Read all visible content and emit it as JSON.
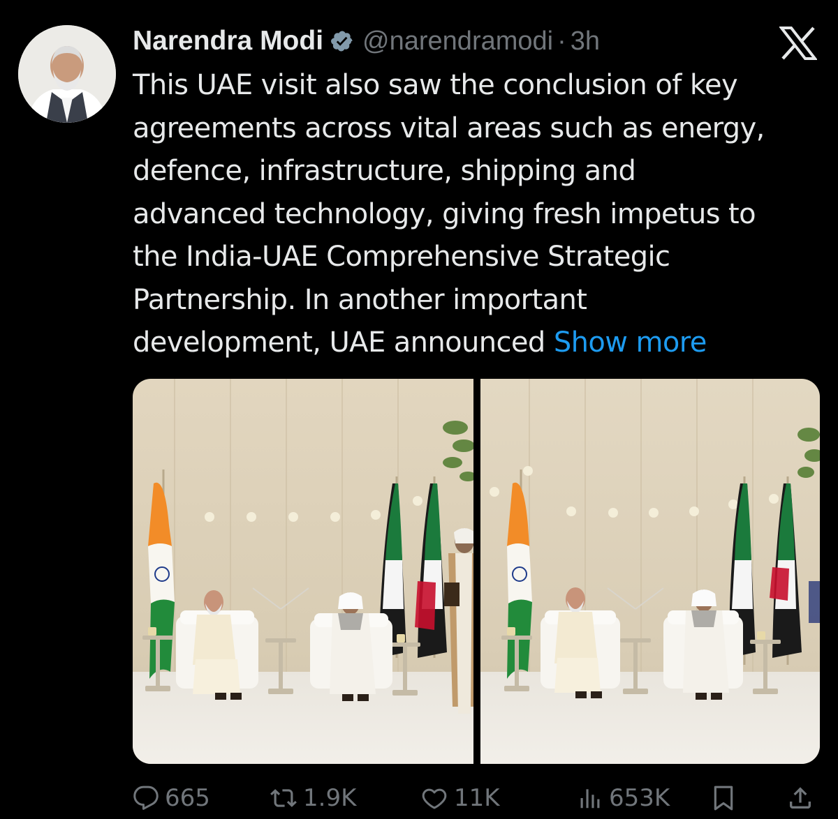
{
  "tweet": {
    "author_name": "Narendra Modi",
    "handle": "@narendramodi",
    "separator": "·",
    "time": "3h",
    "text_lines": [
      "This UAE visit also saw the conclusion of key",
      "agreements across vital areas such as energy,",
      "defence, infrastructure, shipping and",
      "advanced technology, giving fresh impetus to",
      "the India-UAE Comprehensive Strategic",
      "Partnership. In another important",
      "development, UAE announced"
    ],
    "show_more": "Show more",
    "media": {
      "count": 2
    }
  },
  "metrics": {
    "replies": "665",
    "reposts": "1.9K",
    "likes": "11K",
    "views": "653K"
  },
  "colors": {
    "background": "#000000",
    "text": "#e7e9ea",
    "muted": "#71767b",
    "link": "#1d9bf0",
    "verified_badge": "#829aab"
  },
  "icons": {
    "verified": "verified-badge-icon",
    "platform_logo": "x-logo-icon",
    "reply": "reply-icon",
    "repost": "repost-icon",
    "like": "heart-icon",
    "views": "views-icon",
    "bookmark": "bookmark-icon",
    "share": "share-icon"
  }
}
